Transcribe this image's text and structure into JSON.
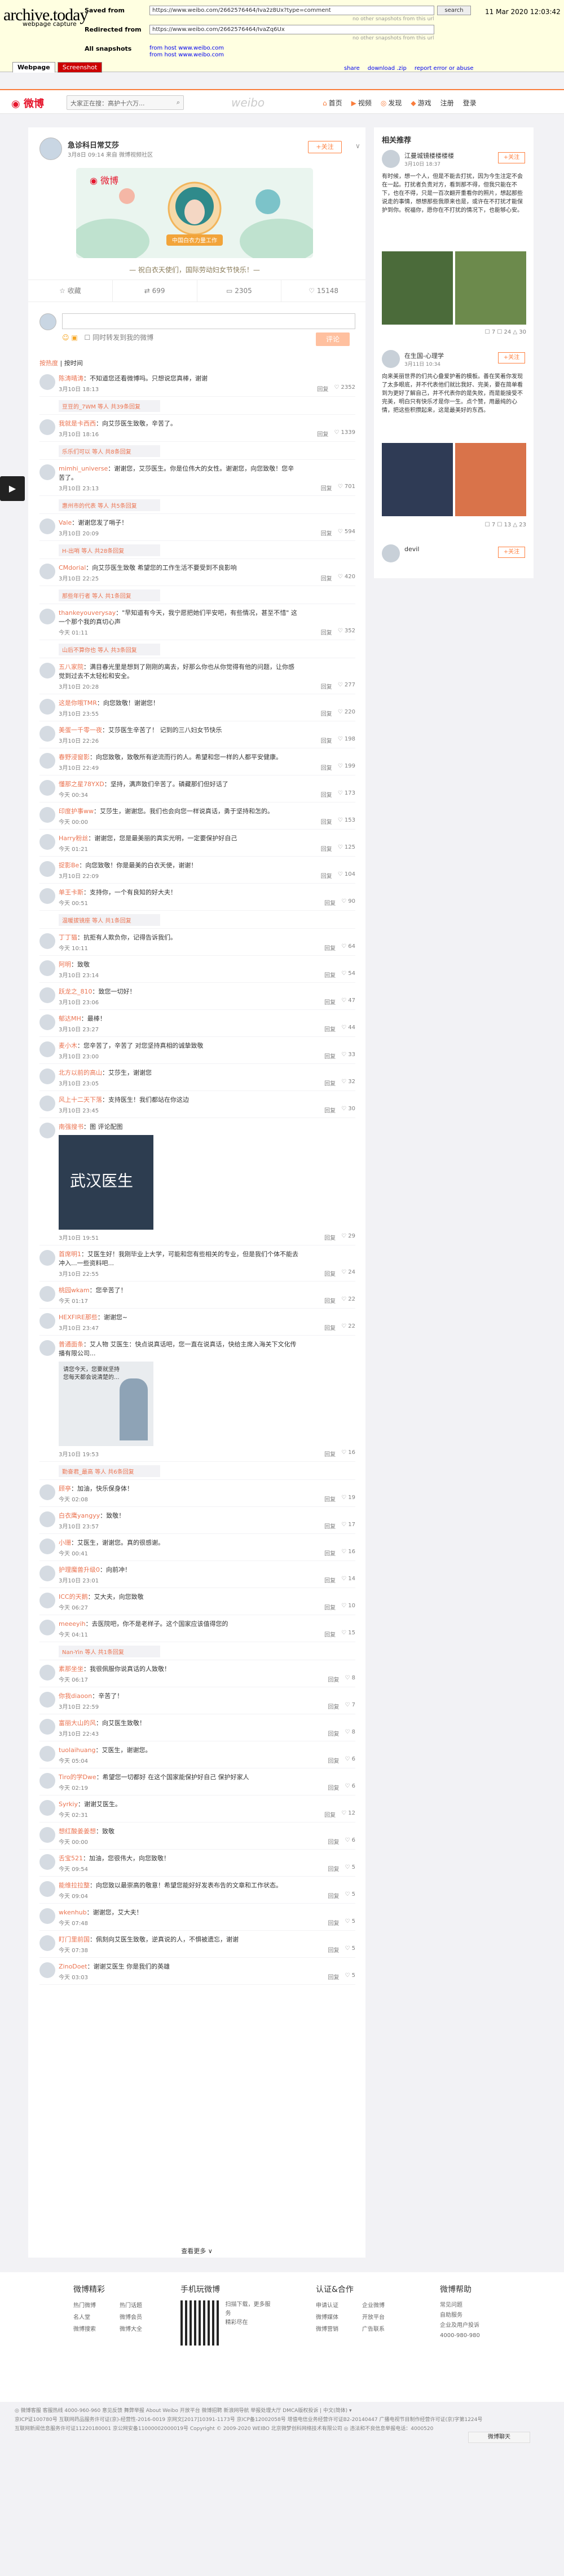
{
  "archive": {
    "logo": "archive.today",
    "logo_sub": "webpage capture",
    "saved_from_label": "Saved from",
    "saved_from_url": "https://www.weibo.com/2662576464/Iva2z8Ux?type=comment",
    "redirected_from_label": "Redirected from",
    "redirected_from_url": "https://www.weibo.com/2662576464/IvaZq6Ux",
    "search_button": "search",
    "date": "11 Mar 2020 12:03:42",
    "no_snapshots_1": "no other snapshots from this url",
    "no_snapshots_2": "no other snapshots from this url",
    "all_snapshots_label": "All snapshots",
    "from_host_1": "from host www.weibo.com",
    "from_host_2": "from host www.weibo.com",
    "tab_webpage": "Webpage",
    "tab_screenshot": "Screenshot",
    "tool_share": "share",
    "tool_download": "download .zip",
    "tool_report": "report error or abuse"
  },
  "nav": {
    "logo": "微博",
    "search_placeholder": "大家正在搜：高护十六万...",
    "weibo_mark": "weibo",
    "items": [
      {
        "icon": "⌂",
        "label": "首页"
      },
      {
        "icon": "▶",
        "label": "视频"
      },
      {
        "icon": "◎",
        "label": "发现"
      },
      {
        "icon": "◆",
        "label": "游戏"
      },
      {
        "icon": "",
        "label": "注册"
      },
      {
        "icon": "",
        "label": "登录"
      }
    ]
  },
  "post": {
    "author": "急诊科日常艾莎",
    "time": "3月8日 09:14 来自 微博视频社区",
    "follow": "+关注",
    "badge": "中国白衣力量工作",
    "banner_quote": "— 祝白衣天使们，国际劳动妇女节快乐！—",
    "caption": "— 祝白衣天使们，国际劳动妇女节快乐！—",
    "actions": [
      {
        "label": "收藏"
      },
      {
        "label": "699"
      },
      {
        "label": "2305"
      },
      {
        "label": "15148"
      }
    ]
  },
  "comment_box": {
    "icons": "☺ ▣",
    "checkbox_label": "同时转发到我的微博",
    "submit": "评论"
  },
  "sort": {
    "label": "按热度",
    "sep": "|",
    "alt": "按时间"
  },
  "comments": [
    {
      "user": "陈涛晴涛",
      "text": "：不知道您还看微博吗。只想说您真棒，谢谢",
      "time": "3月10日 18:13",
      "likes": "2352"
    },
    {
      "sub": "豆豆的_7WM 等人 共39条回复"
    },
    {
      "user": "我就是卡西西",
      "text": "：向艾莎医生致敬，辛苦了。",
      "time": "3月10日 18:16",
      "likes": "1339"
    },
    {
      "sub": "乐乐们可以 等人 共8条回复"
    },
    {
      "user": "mimhi_universe",
      "text": "：谢谢您，艾莎医生。你是位伟大的女性。谢谢您，向您致敬！您辛苦了。",
      "time": "3月10日 23:13",
      "likes": "701"
    },
    {
      "sub": "惠州市的代表 等人 共5条回复"
    },
    {
      "user": "Vale",
      "text": "：谢谢您发了哨子！",
      "time": "3月10日 20:09",
      "likes": "594"
    },
    {
      "sub": "H-出哨 等人 共28条回复"
    },
    {
      "user": "CMdorial",
      "text": "：向艾莎医生致敬 希望您的工作生活不要受到不良影响",
      "time": "3月10日 22:25",
      "likes": "420"
    },
    {
      "sub": "那些年行者 等人 共1条回复"
    },
    {
      "user": "thankeyouverysay",
      "text": "：\"早知道有今天，我宁愿把她们平安吧，有些情况，甚至不惜\" 这一个那个我的真切心声",
      "time": "今天 01:11",
      "likes": "352"
    },
    {
      "sub": "山后不算你也 等人 共3条回复"
    },
    {
      "user": "五八家院",
      "text": "：满目春光里是想到了刚刚的离去，好那么你也从你觉得有他的问题，让你感觉到过去不太轻松和安全。",
      "time": "3月10日 20:28",
      "likes": "277"
    },
    {
      "user": "这是你哦TMR",
      "text": "：向您致敬！谢谢您！",
      "time": "3月10日 23:55",
      "likes": "220"
    },
    {
      "user": "美蛋一千零一夜",
      "text": "：艾莎医生辛苦了！ 记到的三八妇女节快乐",
      "time": "3月10日 22:26",
      "likes": "198"
    },
    {
      "user": "春野浸窗影",
      "text": "：向您致敬，致敬所有逆流而行的人。希望和您一样的人都平安健康。",
      "time": "3月10日 22:49",
      "likes": "199"
    },
    {
      "user": "懂那之星78YXD",
      "text": "：坚持，满声致们辛苦了。磷藏那们但好话了",
      "time": "今天 00:34",
      "likes": "173"
    },
    {
      "user": "印度护事ww",
      "text": "：艾莎生，谢谢您。我们也会向您一样说真话，勇于坚持和怎的。",
      "time": "今天 00:00",
      "likes": "153"
    },
    {
      "user": "Harry粉丝",
      "text": "：谢谢您，您是最美丽的真实光明，一定要保护好自己",
      "time": "今天 01:21",
      "likes": "125"
    },
    {
      "user": "捉影Be",
      "text": "：向您致敬！你是最美的白衣天使，谢谢！",
      "time": "3月10日 22:09",
      "likes": "104"
    },
    {
      "user": "单王卡斯",
      "text": "：支持你，一个有良知的好大夫！",
      "time": "今天 00:51",
      "likes": "90"
    },
    {
      "sub": "温暖拔镜座 等人 共1条回复"
    },
    {
      "user": "丁丁猫",
      "text": "：抗拒有人欺负你，记得告诉我们。",
      "time": "今天 10:11",
      "likes": "64"
    },
    {
      "user": "阿明",
      "text": "：致敬",
      "time": "3月10日 23:14",
      "likes": "54"
    },
    {
      "user": "跃龙之_810",
      "text": "：致您一切好！",
      "time": "3月10日 23:06",
      "likes": "47"
    },
    {
      "user": "郁达MH",
      "text": "：最棒！",
      "time": "3月10日 23:27",
      "likes": "44"
    },
    {
      "user": "麦小木",
      "text": "：您辛苦了，辛苦了 对您坚持真相的诚挚致敬",
      "time": "3月10日 23:00",
      "likes": "33"
    },
    {
      "user": "北方以前的高山",
      "text": "：艾莎生，谢谢您",
      "time": "3月10日 23:05",
      "likes": "32"
    },
    {
      "user": "风上十二天下落",
      "text": "：支持医生！我们都站在你这边",
      "time": "3月10日 23:45",
      "likes": "30"
    },
    {
      "user": "南强搜书",
      "text": "：图 评论配图",
      "time": "3月10日 19:51",
      "likes": "29",
      "image": "武汉医生"
    },
    {
      "user": "首席明1",
      "text": "：艾医生好！我刚毕业上大学，可能和您有些相关的专业，但是我们个体不能去冲入...一些资料吧...",
      "time": "3月10日 22:55",
      "likes": "24"
    },
    {
      "user": "桃园wkam",
      "text": "：您辛苦了！",
      "time": "今天 01:17",
      "likes": "22"
    },
    {
      "user": "HEXFIRE那些",
      "text": "：谢谢您~",
      "time": "3月10日 23:47",
      "likes": "22"
    },
    {
      "user": "普通面条",
      "text": "：艾人物 艾医生：快点说真话吧，您一直在说真话，快给主席入海关下文化传播有限公司...",
      "time": "3月10日 19:53",
      "likes": "16",
      "image2": "请您今天，您要就坚持您每天都会说清楚的..."
    },
    {
      "sub": "勤奋君_最高 等人 共6条回复"
    },
    {
      "user": "顾亭",
      "text": "：加油，快乐保身体！",
      "time": "今天 02:08",
      "likes": "19"
    },
    {
      "user": "白衣鹰yangyy",
      "text": "：致敬！",
      "time": "3月10日 23:57",
      "likes": "17"
    },
    {
      "user": "小珊",
      "text": "：艾医生，谢谢您。真的很感谢。",
      "time": "今天 00:41",
      "likes": "16"
    },
    {
      "user": "护理魔兽升级0",
      "text": "：向前冲！",
      "time": "3月10日 23:01",
      "likes": "14"
    },
    {
      "user": "ICC的天鹅",
      "text": "：艾大夫，向您致敬",
      "time": "今天 06:27",
      "likes": "10"
    },
    {
      "user": "meeeyih",
      "text": "：去医院吧，你不是老样子。这个国家应该值得您的",
      "time": "今天 04:11",
      "likes": "15"
    },
    {
      "sub": "Nan-Yin 等人 共1条回复"
    },
    {
      "user": "素那坐坐",
      "text": "：我很佩服你说真话的人致敬！",
      "time": "今天 06:17",
      "likes": "8"
    },
    {
      "user": "你我diaoon",
      "text": "：辛苦了！",
      "time": "3月10日 22:59",
      "likes": "7"
    },
    {
      "user": "富丽大山的风",
      "text": "：向艾医生致敬！",
      "time": "3月10日 22:43",
      "likes": "8"
    },
    {
      "user": "tuolaihuang",
      "text": "：艾医生，谢谢您。",
      "time": "今天 05:04",
      "likes": "6"
    },
    {
      "user": "Tiro的学Dwe",
      "text": "：希望您一切都好 在这个国家能保护好自己 保护好家人",
      "time": "今天 02:19",
      "likes": "6"
    },
    {
      "user": "Syrkiy",
      "text": "：谢谢艾医生。",
      "time": "今天 02:31",
      "likes": "12"
    },
    {
      "user": "想红酸姜姜想",
      "text": "：致敬",
      "time": "今天 00:00",
      "likes": "6"
    },
    {
      "user": "舌宝521",
      "text": "：加油，您很伟大，向您致敬！",
      "time": "今天 09:54",
      "likes": "5"
    },
    {
      "user": "能维拉拉整",
      "text": "：向您致以最崇高的敬意！希望您能好好发表布告的文章和工作状态。",
      "time": "今天 09:04",
      "likes": "5"
    },
    {
      "user": "wkenhub",
      "text": "：谢谢您，艾大夫！",
      "time": "今天 07:48",
      "likes": "5"
    },
    {
      "user": "盯门里前国",
      "text": "：佩刻向艾医生致敬，逆真说的人，不惧被遗忘，谢谢",
      "time": "今天 07:38",
      "likes": "5"
    },
    {
      "user": "ZinoDoet",
      "text": "：谢谢艾医生 你是我们的英雄",
      "time": "今天 03:03",
      "likes": "5"
    }
  ],
  "more": "查看更多 ∨",
  "side": {
    "title": "相关推荐",
    "cards": [
      {
        "name": "江曼城镜楼楼楼楼",
        "time": "3月10日 18:37",
        "follow": "+关注",
        "text": "有时候，想一个人，但是不能去打扰，因为今生注定不会在一起。打扰者负责对方，看到那不得，但我只能在不下，也在不得，只是一百次翻开重看你的照片，想起那些说走的事情，想想那些我原来也是，或许在不打扰才能保护到你。祝福你，愿你在不打扰的情况下，也能够心安。",
        "stats": "☐ 7  ☐ 24  △ 30"
      },
      {
        "name": "在生国-心理学",
        "time": "3月11日 10:34",
        "follow": "+关注",
        "text": "向来美丽世界的们共心叠爱护着的模板。善在笑着你发现了太多眼底，并不代表他们就比我好、完美，要在简单看到为更好了解自己，并不代表你的是失败，而是能接受不完美，明白只有快乐才是你一生。点个赞，用最纯的心情，把这些积攒起来，这是最美好的东西。",
        "stats": "☐ 7  ☐ 13  △ 23"
      },
      {
        "name": "devil",
        "time": "",
        "follow": "+关注",
        "text": "",
        "stats": ""
      }
    ]
  },
  "footer": {
    "cols": [
      {
        "title": "微博精彩",
        "links": [
          "热门微博",
          "热门话题",
          "名人堂",
          "微博会员",
          "微博搜索",
          "微博大全"
        ]
      },
      {
        "title": "手机玩微博",
        "links": [
          "扫描下载，更多服务",
          "精彩尽在"
        ]
      },
      {
        "title": "认证&合作",
        "links": [
          "申请认证",
          "企业微博",
          "微博媒体",
          "开放平台",
          "微博营销",
          "广告联系"
        ]
      },
      {
        "title": "微博帮助",
        "links": [
          "常见问题",
          "自助服务",
          "企业及用户投诉",
          "4000-980-980"
        ]
      }
    ],
    "bottom_lines": [
      "◎ 微博客服  客服热线 4000-960-960  意见反馈  舞弊举报  About Weibo  开放平台  微博招聘  新浪网导航  举报处理大厅  DMCA版权投诉 | 中文(简体) ▾",
      "京ICP证100780号  互联网药品服务许可证(京)-经营性-2016-0019  京网文[2017]10391-1173号  京ICP备12002058号  增值电信业务经营许可证B2-20140447  广播电视节目制作经营许可证(京)字第1224号",
      "互联网新闻信息服务许可证11220180001  京公网安备11000002000019号  Copyright © 2009-2020 WEIBO 北京微梦创科网络技术有限公司  ◎ 违法和不良信息举报电话：4000520"
    ],
    "bottom_tab": "微博聊天"
  }
}
